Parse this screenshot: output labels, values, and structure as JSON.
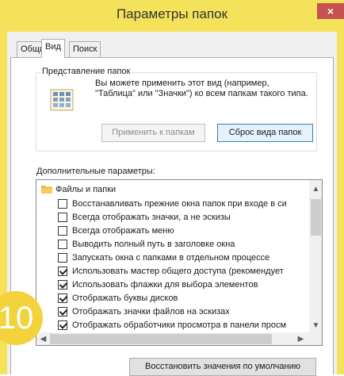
{
  "window": {
    "title": "Параметры папок",
    "close_glyph": "×"
  },
  "tabs": [
    {
      "label": "Общие",
      "active": false
    },
    {
      "label": "Вид",
      "active": true
    },
    {
      "label": "Поиск",
      "active": false
    }
  ],
  "folder_view": {
    "group_label": "Представление папок",
    "description": "Вы можете применить этот вид (например, \"Таблица\" или \"Значки\") ко всем папкам такого типа.",
    "apply_button": "Применить к папкам",
    "reset_button": "Сброс вида папок",
    "icon": "folder-view-icon"
  },
  "advanced": {
    "label": "Дополнительные параметры:",
    "root": {
      "label": "Файлы и папки",
      "icon": "folder-icon"
    },
    "items": [
      {
        "label": "Восстанавливать прежние окна папок при входе в си",
        "checked": false
      },
      {
        "label": "Всегда отображать значки, а не эскизы",
        "checked": false
      },
      {
        "label": "Всегда отображать меню",
        "checked": false
      },
      {
        "label": "Выводить полный путь в заголовке окна",
        "checked": false
      },
      {
        "label": "Запускать окна с папками в отдельном процессе",
        "checked": false
      },
      {
        "label": "Использовать мастер общего доступа (рекомендует",
        "checked": true
      },
      {
        "label": "Использовать флажки для выбора элементов",
        "checked": true
      },
      {
        "label": "Отображать буквы дисков",
        "checked": true
      },
      {
        "label": "Отображать значки файлов на эскизах",
        "checked": true
      },
      {
        "label": "Отображать обработчики просмотра в панели просм",
        "checked": true
      }
    ]
  },
  "restore_button": "Восстановить значения по умолчанию",
  "step_badge": "10",
  "colors": {
    "frame": "#f5e25b",
    "close": "#c75050",
    "badge": "#f3d23b"
  }
}
